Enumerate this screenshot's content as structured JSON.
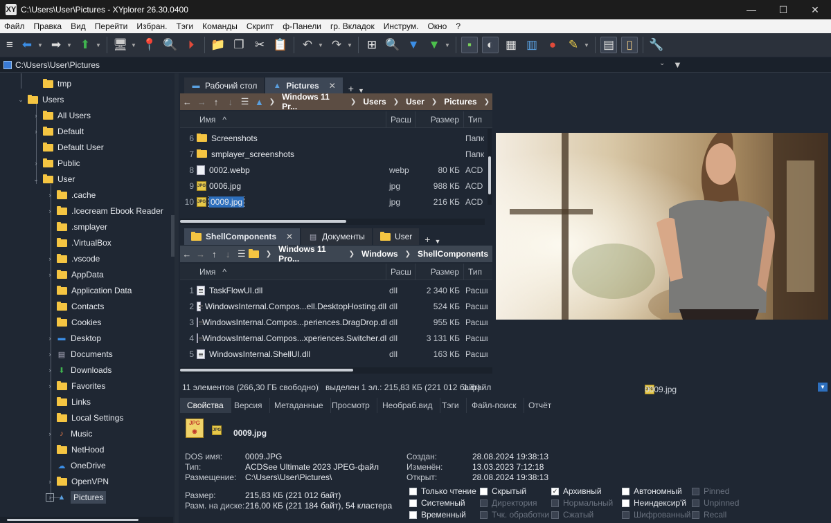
{
  "window": {
    "title": "C:\\Users\\User\\Pictures - XYplorer 26.30.0400",
    "app_icon": "XY"
  },
  "menu": [
    "Файл",
    "Правка",
    "Вид",
    "Перейти",
    "Избран.",
    "Тэги",
    "Команды",
    "Скрипт",
    "ф-Панели",
    "гр. Вкладок",
    "Инструм.",
    "Окно",
    "?"
  ],
  "address": {
    "path": "C:\\Users\\User\\Pictures"
  },
  "tree": {
    "items": [
      {
        "label": "tmp",
        "level": 3,
        "arrow": ""
      },
      {
        "label": "Users",
        "level": 2,
        "arrow": "open"
      },
      {
        "label": "All Users",
        "level": 3,
        "arrow": "closed"
      },
      {
        "label": "Default",
        "level": 3,
        "arrow": "closed"
      },
      {
        "label": "Default User",
        "level": 3,
        "arrow": ""
      },
      {
        "label": "Public",
        "level": 3,
        "arrow": "closed"
      },
      {
        "label": "User",
        "level": 3,
        "arrow": "open"
      },
      {
        "label": ".cache",
        "level": 4,
        "arrow": "closed"
      },
      {
        "label": ".Icecream Ebook Reader",
        "level": 4,
        "arrow": "closed"
      },
      {
        "label": ".smplayer",
        "level": 4,
        "arrow": ""
      },
      {
        "label": ".VirtualBox",
        "level": 4,
        "arrow": ""
      },
      {
        "label": ".vscode",
        "level": 4,
        "arrow": "closed"
      },
      {
        "label": "AppData",
        "level": 4,
        "arrow": "closed"
      },
      {
        "label": "Application Data",
        "level": 4,
        "arrow": ""
      },
      {
        "label": "Contacts",
        "level": 4,
        "arrow": ""
      },
      {
        "label": "Cookies",
        "level": 4,
        "arrow": ""
      },
      {
        "label": "Desktop",
        "level": 4,
        "arrow": "closed"
      },
      {
        "label": "Documents",
        "level": 4,
        "arrow": "closed"
      },
      {
        "label": "Downloads",
        "level": 4,
        "arrow": "closed"
      },
      {
        "label": "Favorites",
        "level": 4,
        "arrow": "closed"
      },
      {
        "label": "Links",
        "level": 4,
        "arrow": ""
      },
      {
        "label": "Local Settings",
        "level": 4,
        "arrow": ""
      },
      {
        "label": "Music",
        "level": 4,
        "arrow": "closed"
      },
      {
        "label": "NetHood",
        "level": 4,
        "arrow": ""
      },
      {
        "label": "OneDrive",
        "level": 4,
        "arrow": ""
      },
      {
        "label": "OpenVPN",
        "level": 4,
        "arrow": "closed"
      },
      {
        "label": "Pictures",
        "level": 4,
        "arrow": "boxed",
        "selected": true
      }
    ]
  },
  "pane1": {
    "tabs": [
      {
        "label": "Рабочий стол",
        "active": false
      },
      {
        "label": "Pictures",
        "active": true
      }
    ],
    "breadcrumb": [
      "Windows 11 Pr...",
      "Users",
      "User",
      "Pictures"
    ],
    "columns": {
      "name": "Имя",
      "ext": "Расш",
      "size": "Размер",
      "type": "Тип"
    },
    "rows": [
      {
        "num": "6",
        "name": "Screenshots",
        "ext": "",
        "size": "",
        "type": "Папк",
        "icon": "folder"
      },
      {
        "num": "7",
        "name": "smplayer_screenshots",
        "ext": "",
        "size": "",
        "type": "Папк",
        "icon": "folder"
      },
      {
        "num": "8",
        "name": "0002.webp",
        "ext": "webp",
        "size": "80 КБ",
        "type": "ACD",
        "icon": "webp"
      },
      {
        "num": "9",
        "name": "0006.jpg",
        "ext": "jpg",
        "size": "988 КБ",
        "type": "ACD",
        "icon": "jpg"
      },
      {
        "num": "10",
        "name": "0009.jpg",
        "ext": "jpg",
        "size": "216 КБ",
        "type": "ACD",
        "icon": "jpg",
        "selected": true
      }
    ]
  },
  "pane2": {
    "tabs": [
      {
        "label": "ShellComponents",
        "active": true
      },
      {
        "label": "Документы",
        "active": false
      },
      {
        "label": "User",
        "active": false
      }
    ],
    "breadcrumb": [
      "Windows 11 Pro...",
      "Windows",
      "ShellComponents"
    ],
    "columns": {
      "name": "Имя",
      "ext": "Расш",
      "size": "Размер",
      "type": "Тип"
    },
    "rows": [
      {
        "num": "1",
        "name": "TaskFlowUI.dll",
        "ext": "dll",
        "size": "2 340 КБ",
        "type": "Расши"
      },
      {
        "num": "2",
        "name": "WindowsInternal.Compos...ell.DesktopHosting.dll",
        "ext": "dll",
        "size": "524 КБ",
        "type": "Расши"
      },
      {
        "num": "3",
        "name": "WindowsInternal.Compos...periences.DragDrop.dll",
        "ext": "dll",
        "size": "955 КБ",
        "type": "Расши"
      },
      {
        "num": "4",
        "name": "WindowsInternal.Compos...xperiences.Switcher.dll",
        "ext": "dll",
        "size": "3 131 КБ",
        "type": "Расши"
      },
      {
        "num": "5",
        "name": "WindowsInternal.ShellUI.dll",
        "ext": "dll",
        "size": "163 КБ",
        "type": "Расши"
      }
    ]
  },
  "status": {
    "count": "11 элементов (266,30 ГБ свободно)",
    "selected": "выделен 1 эл.: 215,83 КБ (221 012 байт)",
    "files": "1 файл",
    "current": "0009.jpg"
  },
  "info_tabs": [
    "Свойства",
    "Версия",
    "Метаданные",
    "Просмотр",
    "Необраб.вид",
    "Тэги",
    "Файл-поиск",
    "Отчёт"
  ],
  "info": {
    "filename": "0009.jpg",
    "dos_label": "DOS имя:",
    "dos": "0009.JPG",
    "type_label": "Тип:",
    "type": "ACDSee Ultimate 2023 JPEG-файл",
    "loc_label": "Размещение:",
    "loc": "C:\\Users\\User\\Pictures\\",
    "size_label": "Размер:",
    "size": "215,83 КБ (221 012 байт)",
    "disk_label": "Разм. на диске:",
    "disk": "216,00 КБ (221 184 байт), 54 кластера",
    "created_label": "Создан:",
    "created": "28.08.2024 19:38:13",
    "modified_label": "Изменён:",
    "modified": "13.03.2023 7:12:18",
    "opened_label": "Открыт:",
    "opened": "28.08.2024 19:38:13",
    "attributes": [
      {
        "label": "Только чтение",
        "checked": false,
        "disabled": false
      },
      {
        "label": "Системный",
        "checked": false,
        "disabled": false
      },
      {
        "label": "Временный",
        "checked": false,
        "disabled": false
      },
      {
        "label": "Скрытый",
        "checked": false,
        "disabled": false
      },
      {
        "label": "Директория",
        "checked": false,
        "disabled": true
      },
      {
        "label": "Тчк. обработки",
        "checked": false,
        "disabled": true
      },
      {
        "label": "Архивный",
        "checked": true,
        "disabled": false
      },
      {
        "label": "Нормальный",
        "checked": false,
        "disabled": true
      },
      {
        "label": "Сжатый",
        "checked": false,
        "disabled": true
      },
      {
        "label": "Автономный",
        "checked": false,
        "disabled": false
      },
      {
        "label": "Неиндексир'й",
        "checked": false,
        "disabled": false
      },
      {
        "label": "Шифрованный",
        "checked": false,
        "disabled": true
      },
      {
        "label": "Pinned",
        "checked": false,
        "disabled": true
      },
      {
        "label": "Unpinned",
        "checked": false,
        "disabled": true
      },
      {
        "label": "Recall",
        "checked": false,
        "disabled": true
      }
    ]
  },
  "colors": {
    "accent": "#2d6fbd",
    "breadcrumb_top": "#5c4d43",
    "folder": "#f5c542"
  }
}
